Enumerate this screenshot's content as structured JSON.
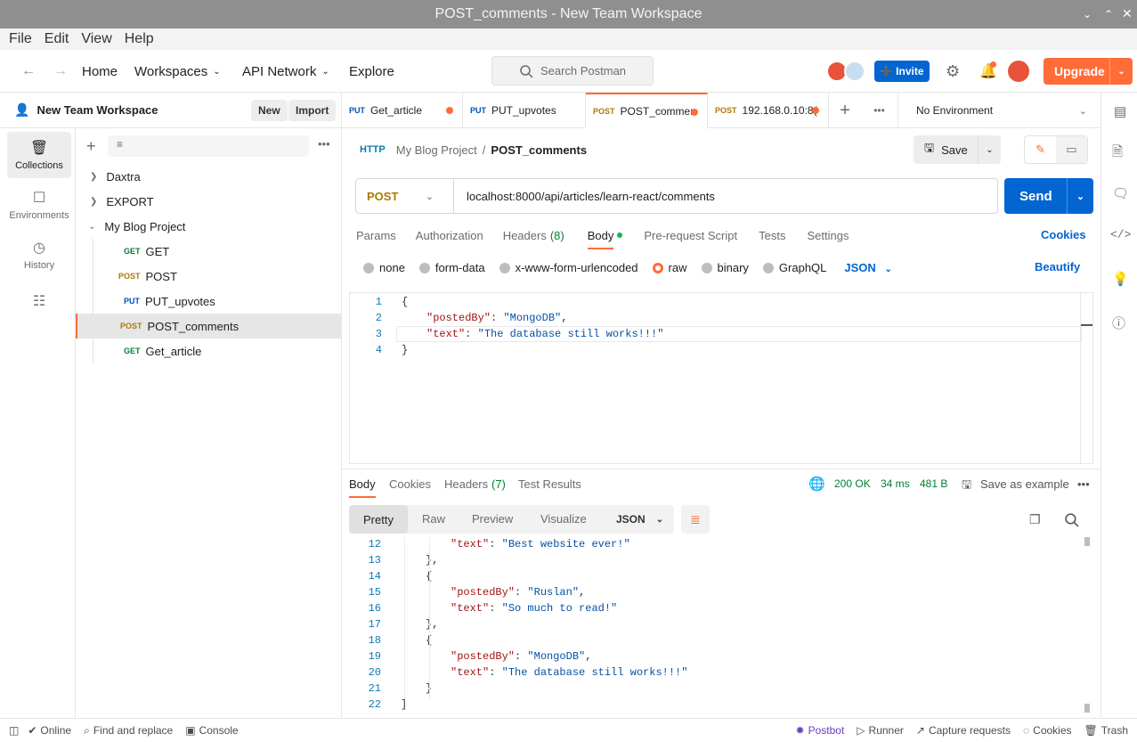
{
  "window": {
    "title": "POST_comments - New Team Workspace"
  },
  "menu": [
    "File",
    "Edit",
    "View",
    "Help"
  ],
  "header": {
    "home": "Home",
    "workspaces": "Workspaces",
    "api_network": "API Network",
    "explore": "Explore",
    "search_placeholder": "Search Postman",
    "invite": "Invite",
    "upgrade": "Upgrade"
  },
  "sidebar": {
    "workspace_name": "New Team Workspace",
    "new_label": "New",
    "import_label": "Import",
    "rail": [
      {
        "label": "Collections",
        "icon": "collections-icon"
      },
      {
        "label": "Environments",
        "icon": "environments-icon"
      },
      {
        "label": "History",
        "icon": "history-icon"
      }
    ],
    "tree": [
      {
        "label": "Daxtra",
        "type": "folder",
        "expanded": false
      },
      {
        "label": "EXPORT",
        "type": "folder",
        "expanded": false
      },
      {
        "label": "My Blog Project",
        "type": "folder",
        "expanded": true
      },
      {
        "method": "GET",
        "label": "GET"
      },
      {
        "method": "POST",
        "label": "POST"
      },
      {
        "method": "PUT",
        "label": "PUT_upvotes"
      },
      {
        "method": "POST",
        "label": "POST_comments",
        "active": true
      },
      {
        "method": "GET",
        "label": "Get_article"
      }
    ]
  },
  "tabs": [
    {
      "method": "PUT",
      "label": "Get_article",
      "unsaved": true
    },
    {
      "method": "PUT",
      "label": "PUT_upvotes",
      "unsaved": false
    },
    {
      "method": "POST",
      "label": "POST_commer",
      "unsaved": true,
      "active": true
    },
    {
      "method": "POST",
      "label": "192.168.0.10:8(",
      "unsaved": true
    }
  ],
  "environment": "No Environment",
  "request": {
    "breadcrumb_parent": "My Blog Project",
    "breadcrumb_sep": "/",
    "name": "POST_comments",
    "save": "Save",
    "method": "POST",
    "url": "localhost:8000/api/articles/learn-react/comments",
    "send": "Send",
    "tabs": [
      "Params",
      "Authorization",
      "Headers",
      "(8)",
      "Body",
      "Pre-request Script",
      "Tests",
      "Settings"
    ],
    "cookies": "Cookies",
    "body_types": [
      "none",
      "form-data",
      "x-www-form-urlencoded",
      "raw",
      "binary",
      "GraphQL"
    ],
    "body_format": "JSON",
    "beautify": "Beautify",
    "body_lines": [
      {
        "n": "1",
        "text": "{"
      },
      {
        "n": "2",
        "key": "\"postedBy\"",
        "val": "\"MongoDB\"",
        "tail": ","
      },
      {
        "n": "3",
        "key": "\"text\"",
        "val": "\"The database still works!!!\"",
        "tail": ""
      },
      {
        "n": "4",
        "text": "}"
      }
    ]
  },
  "response": {
    "tabs": [
      "Body",
      "Cookies",
      "Headers",
      "(7)",
      "Test Results"
    ],
    "status": "200 OK",
    "time": "34 ms",
    "size": "481 B",
    "save_example": "Save as example",
    "views": [
      "Pretty",
      "Raw",
      "Preview",
      "Visualize"
    ],
    "format": "JSON",
    "lines": [
      {
        "n": "12",
        "indent": 2,
        "key": "\"text\"",
        "val": "\"Best website ever!\"",
        "tail": ""
      },
      {
        "n": "13",
        "indent": 1,
        "text": "},"
      },
      {
        "n": "14",
        "indent": 1,
        "text": "{"
      },
      {
        "n": "15",
        "indent": 2,
        "key": "\"postedBy\"",
        "val": "\"Ruslan\"",
        "tail": ","
      },
      {
        "n": "16",
        "indent": 2,
        "key": "\"text\"",
        "val": "\"So much to read!\"",
        "tail": ""
      },
      {
        "n": "17",
        "indent": 1,
        "text": "},"
      },
      {
        "n": "18",
        "indent": 1,
        "text": "{"
      },
      {
        "n": "19",
        "indent": 2,
        "key": "\"postedBy\"",
        "val": "\"MongoDB\"",
        "tail": ","
      },
      {
        "n": "20",
        "indent": 2,
        "key": "\"text\"",
        "val": "\"The database still works!!!\"",
        "tail": ""
      },
      {
        "n": "21",
        "indent": 1,
        "text": "}"
      },
      {
        "n": "22",
        "indent": 0,
        "text": "]"
      }
    ]
  },
  "statusbar": {
    "online": "Online",
    "find_replace": "Find and replace",
    "console": "Console",
    "postbot": "Postbot",
    "runner": "Runner",
    "capture": "Capture requests",
    "cookies": "Cookies",
    "trash": "Trash"
  },
  "colors": {
    "accent": "#ff6c37",
    "primary": "#0265d2",
    "success": "#007f31"
  }
}
